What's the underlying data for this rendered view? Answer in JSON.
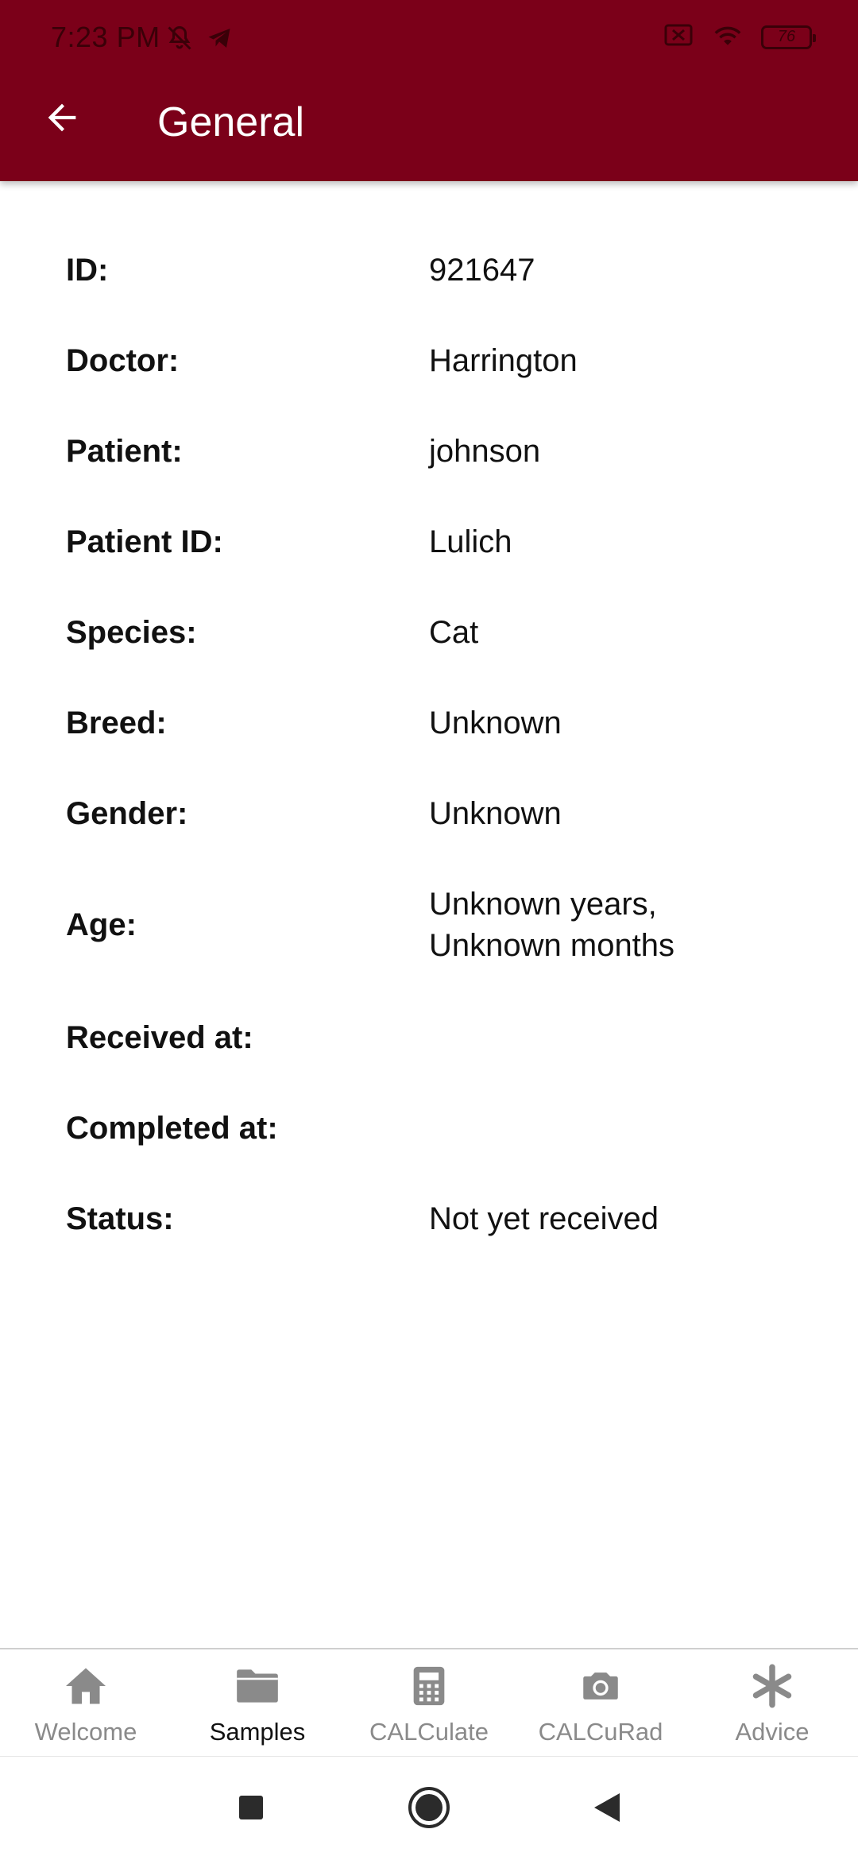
{
  "status_bar": {
    "time": "7:23 PM",
    "battery": "76",
    "icons": [
      "bell-off-icon",
      "telegram-icon",
      "sim-off-icon",
      "wifi-icon",
      "battery-icon"
    ]
  },
  "app_bar": {
    "title": "General",
    "back_icon": "arrow-left-icon",
    "background_color": "#7b0019"
  },
  "details": [
    {
      "label": "ID:",
      "value": "921647"
    },
    {
      "label": "Doctor:",
      "value": "Harrington"
    },
    {
      "label": "Patient:",
      "value": "johnson"
    },
    {
      "label": "Patient ID:",
      "value": "Lulich"
    },
    {
      "label": "Species:",
      "value": "Cat"
    },
    {
      "label": "Breed:",
      "value": "Unknown"
    },
    {
      "label": "Gender:",
      "value": "Unknown"
    },
    {
      "label": "Age:",
      "value_line1": "Unknown years,",
      "value_line2": "Unknown months"
    },
    {
      "label": "Received at:",
      "value": ""
    },
    {
      "label": "Completed at:",
      "value": ""
    },
    {
      "label": "Status:",
      "value": "Not yet received"
    }
  ],
  "bottom_nav": {
    "items": [
      {
        "label": "Welcome",
        "icon": "home-icon",
        "active": false
      },
      {
        "label": "Samples",
        "icon": "folder-icon",
        "active": true
      },
      {
        "label": "CALCulate",
        "icon": "calculator-icon",
        "active": false
      },
      {
        "label": "CALCuRad",
        "icon": "camera-icon",
        "active": false
      },
      {
        "label": "Advice",
        "icon": "asterisk-icon",
        "active": false
      }
    ],
    "active_color": "#111111",
    "inactive_color": "#8a8a8a"
  },
  "system_nav": {
    "buttons": [
      "recents-square-icon",
      "home-circle-icon",
      "back-triangle-icon"
    ]
  }
}
